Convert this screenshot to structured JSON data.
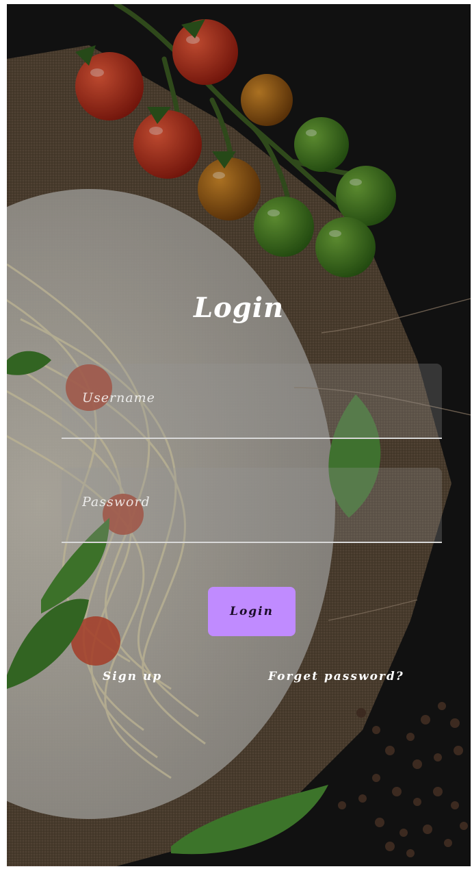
{
  "screen": {
    "title": "Login"
  },
  "form": {
    "username_placeholder": "Username",
    "password_placeholder": "Password",
    "login_label": "Login"
  },
  "links": {
    "signup_label": "Sign up",
    "forget_label": "Forget password?"
  },
  "colors": {
    "accent": "#c08bff",
    "background": "#151515"
  }
}
